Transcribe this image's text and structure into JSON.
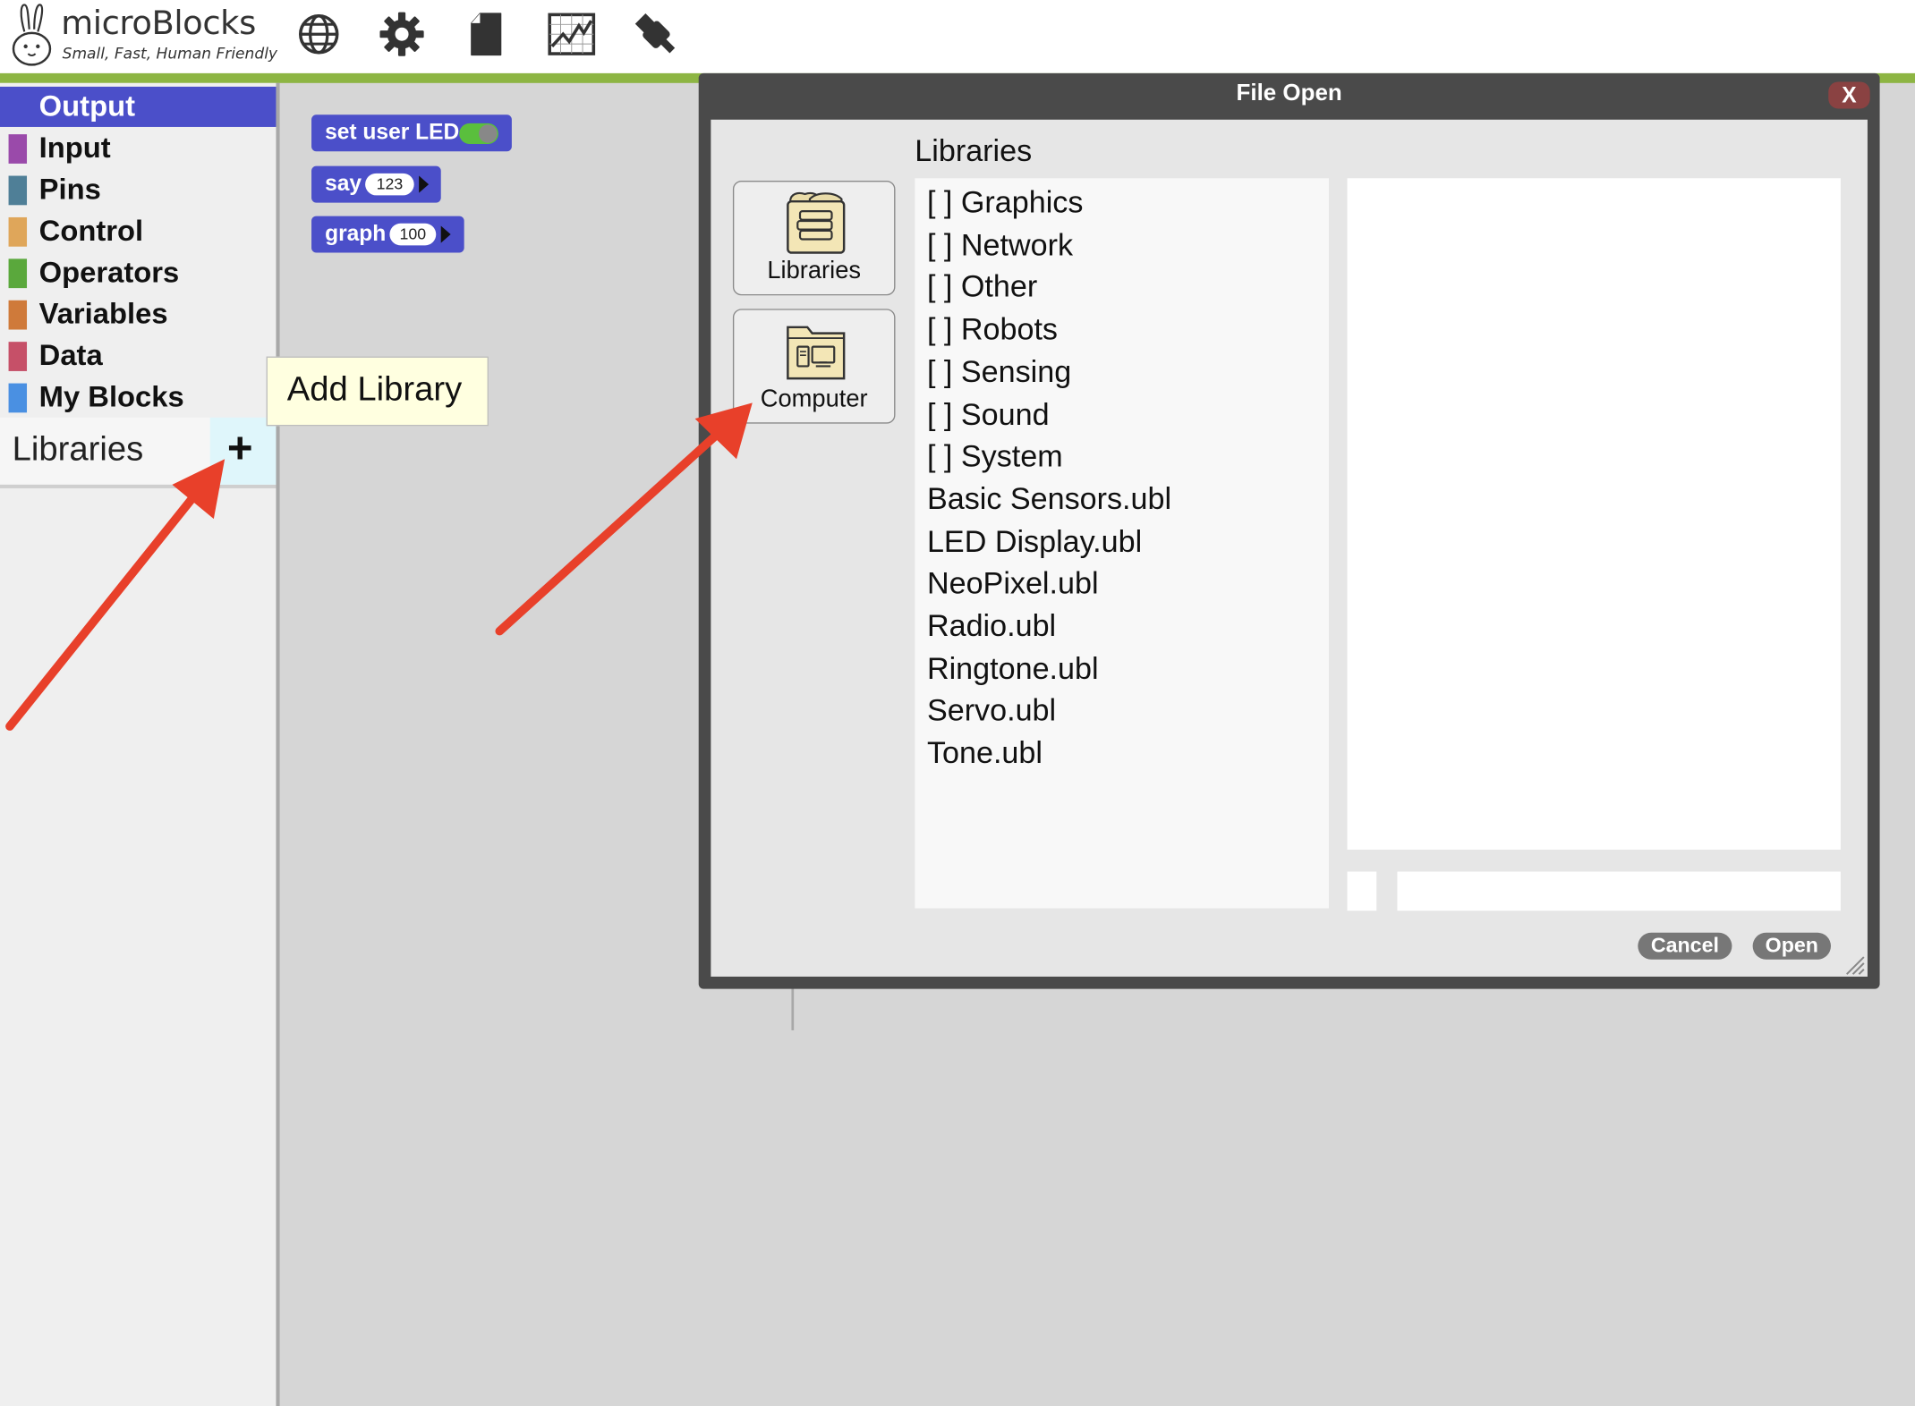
{
  "app": {
    "name": "microBlocks",
    "tagline": "Small, Fast, Human Friendly",
    "toolbar": [
      "globe-icon",
      "gear-icon",
      "file-icon",
      "graph-icon",
      "usb-plug-icon"
    ],
    "accent_color": "#8db543"
  },
  "palette": {
    "categories": [
      {
        "label": "Output",
        "color": "#4b4fc9",
        "selected": true
      },
      {
        "label": "Input",
        "color": "#9a4aaa"
      },
      {
        "label": "Pins",
        "color": "#4f7f97"
      },
      {
        "label": "Control",
        "color": "#dfa65a"
      },
      {
        "label": "Operators",
        "color": "#5aa83c"
      },
      {
        "label": "Variables",
        "color": "#cf7a3a"
      },
      {
        "label": "Data",
        "color": "#c65068"
      },
      {
        "label": "My Blocks",
        "color": "#4a90e2"
      }
    ],
    "libraries_label": "Libraries",
    "add_library_symbol": "+"
  },
  "blocks": [
    {
      "label": "set user LED",
      "toggle": true
    },
    {
      "label": "say",
      "value": "123"
    },
    {
      "label": "graph",
      "value": "100"
    }
  ],
  "tooltip": {
    "text": "Add Library"
  },
  "dialog": {
    "title": "File Open",
    "close_label": "X",
    "sources": [
      {
        "label": "Libraries",
        "icon": "books-icon"
      },
      {
        "label": "Computer",
        "icon": "computer-folder-icon"
      }
    ],
    "list_title": "Libraries",
    "files": [
      "[ ] Graphics",
      "[ ] Network",
      "[ ] Other",
      "[ ] Robots",
      "[ ] Sensing",
      "[ ] Sound",
      "[ ] System",
      "Basic Sensors.ubl",
      "LED Display.ubl",
      "NeoPixel.ubl",
      "Radio.ubl",
      "Ringtone.ubl",
      "Servo.ubl",
      "Tone.ubl"
    ],
    "filename_value": "",
    "cancel_label": "Cancel",
    "open_label": "Open"
  },
  "annotation_color": "#e8402a"
}
